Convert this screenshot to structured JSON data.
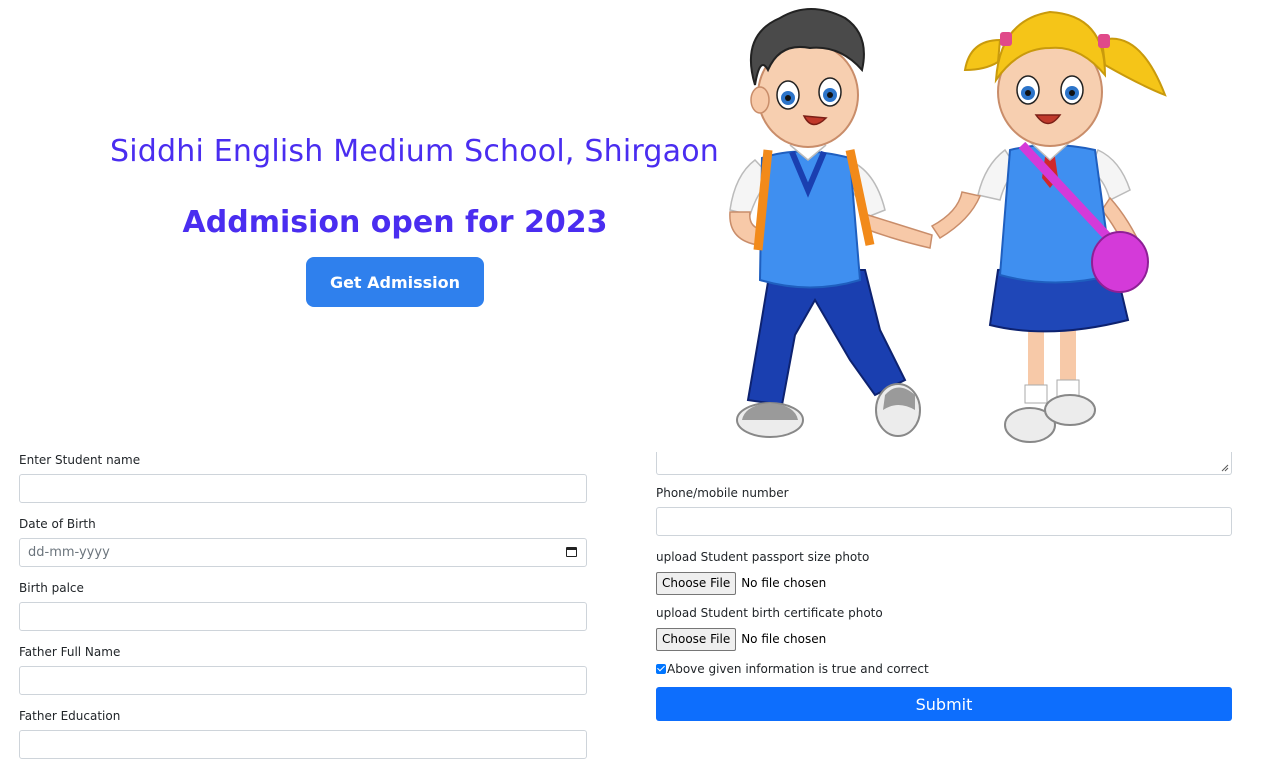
{
  "hero": {
    "title": "Siddhi English Medium School, Shirgaon",
    "subtitle": "Addmision open for 2023",
    "cta_label": "Get Admission"
  },
  "form_left": {
    "student_name_label": "Enter Student name",
    "dob_label": "Date of Birth",
    "dob_placeholder": "dd-mm-yyyy",
    "birth_place_label": "Birth palce",
    "father_name_label": "Father Full Name",
    "father_education_label": "Father Education"
  },
  "form_right": {
    "phone_label": "Phone/mobile number",
    "passport_photo_label": "upload Student passport size photo",
    "birth_cert_label": "upload Student birth certificate photo",
    "choose_file_label": "Choose File",
    "no_file_text": "No file chosen",
    "declaration_label": "Above given information is true and correct",
    "declaration_checked": true,
    "submit_label": "Submit"
  },
  "icons": {
    "calendar": "calendar-icon",
    "illustration": "school-children-illustration"
  },
  "colors": {
    "heading": "#4a2df0",
    "cta": "#2f80ed",
    "submit": "#0d6efd"
  }
}
